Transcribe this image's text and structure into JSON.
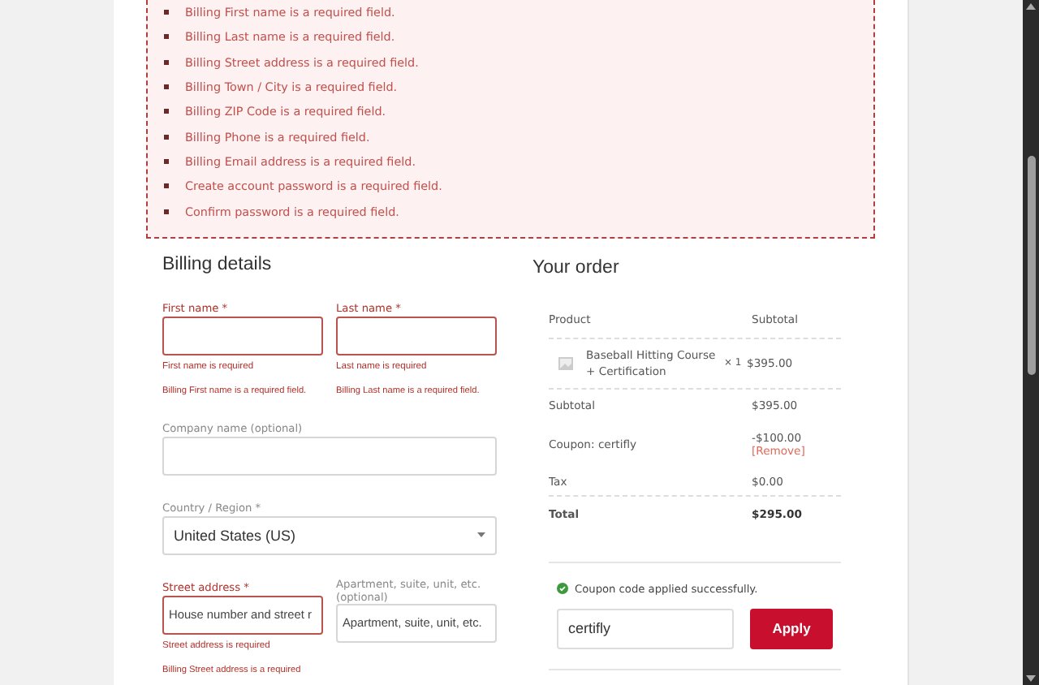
{
  "notices": [
    "Billing First name is a required field.",
    "Billing Last name is a required field.",
    "Billing Street address is a required field.",
    "Billing Town / City is a required field.",
    "Billing ZIP Code is a required field.",
    "Billing Phone is a required field.",
    "Billing Email address is a required field.",
    "Create account password is a required field.",
    "Confirm password is a required field."
  ],
  "billing": {
    "title": "Billing details",
    "rows": [
      [
        {
          "kind": "text",
          "label": "First name",
          "asterisk": "*",
          "invalid": true,
          "hint": "First name is required",
          "error": "Billing First name is a required field."
        },
        {
          "kind": "text",
          "label": "Last name",
          "asterisk": "*",
          "invalid": true,
          "hint": "Last name is required",
          "error": "Billing Last name is a required field."
        }
      ],
      [
        {
          "kind": "text",
          "label": "Company name (optional)",
          "invalid": false
        }
      ],
      [
        {
          "kind": "select",
          "label": "Country / Region",
          "asterisk": "*",
          "invalid": false,
          "value": "United States (US)"
        }
      ],
      [
        {
          "kind": "text",
          "label": "Street address",
          "asterisk": "*",
          "invalid": true,
          "placeholder": "House number and street r",
          "hint": "Street address is required",
          "error": "Billing Street address is a required"
        },
        {
          "kind": "text",
          "label": "Apartment, suite, unit, etc. (optional)",
          "invalid": false,
          "placeholder": "Apartment, suite, unit, etc."
        }
      ]
    ]
  },
  "order": {
    "title": "Your order",
    "columns": [
      "Product",
      "Subtotal"
    ],
    "items": [
      {
        "name": "Baseball Hitting Course + Certification",
        "quantity": "× 1",
        "price": "$395.00"
      }
    ],
    "totals": [
      {
        "kind": "plain",
        "label": "Subtotal",
        "value": "$395.00"
      },
      {
        "kind": "coupon",
        "label": "Coupon: certifly",
        "value": "-$100.00",
        "action": "[Remove]"
      },
      {
        "kind": "plain",
        "label": "Tax",
        "value": "$0.00"
      },
      {
        "kind": "total",
        "label": "Total",
        "value": "$295.00"
      }
    ],
    "coupon": {
      "message": "Coupon code applied successfully.",
      "value": "certifly",
      "button": "Apply"
    }
  }
}
